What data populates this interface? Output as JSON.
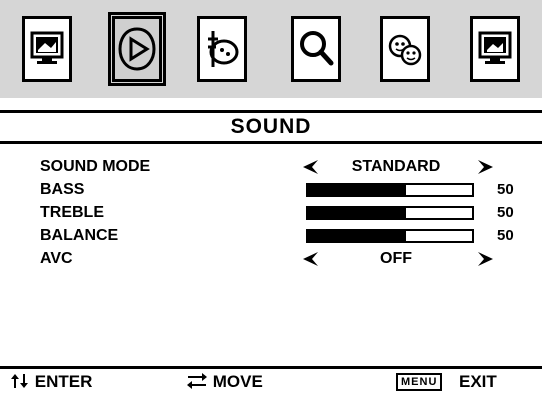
{
  "menu": {
    "tabs": [
      {
        "name": "picture-icon"
      },
      {
        "name": "sound-icon",
        "selected": true
      },
      {
        "name": "time-icon"
      },
      {
        "name": "search-icon"
      },
      {
        "name": "option-icon"
      },
      {
        "name": "lock-icon"
      }
    ],
    "title": "SOUND"
  },
  "settings": {
    "sound_mode": {
      "label": "SOUND MODE",
      "value": "STANDARD"
    },
    "bass": {
      "label": "BASS",
      "value": "50",
      "level_percent": 60
    },
    "treble": {
      "label": "TREBLE",
      "value": "50",
      "level_percent": 60
    },
    "balance": {
      "label": "BALANCE",
      "value": "50",
      "level_percent": 60
    },
    "avc": {
      "label": "AVC",
      "value": "OFF"
    }
  },
  "footer": {
    "enter": "ENTER",
    "move": "MOVE",
    "menu_key": "MENU",
    "exit": "EXIT"
  },
  "colors": {
    "foreground": "#000000",
    "background": "#ffffff",
    "tab_bar": "#d6d6d6"
  }
}
